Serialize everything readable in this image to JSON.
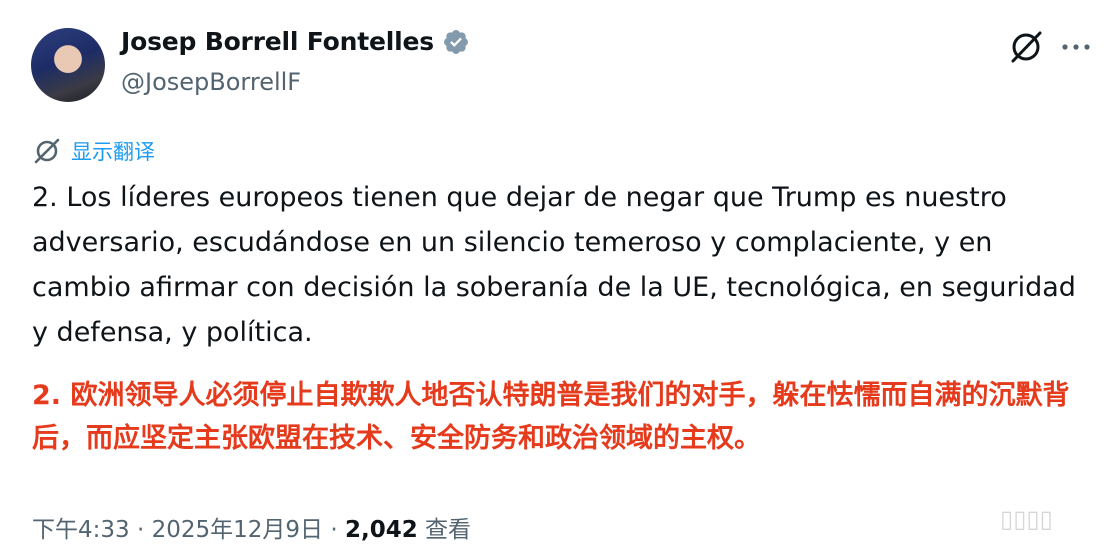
{
  "author": {
    "display_name": "Josep Borrell Fontelles",
    "handle": "@JosepBorrellF",
    "verified_icon": "verified-badge-icon"
  },
  "actions": {
    "grok_icon": "grok-icon",
    "more_icon": "more-horizontal-icon"
  },
  "translate": {
    "icon": "translate-icon",
    "label": "显示翻译"
  },
  "post": {
    "text": "2. Los líderes europeos tienen que dejar de negar que Trump es nuestro adversario, escudándose en un silencio temeroso y complaciente, y en cambio afirmar con decisión la soberanía de la UE, tecnológica,  en seguridad y defensa, y política.",
    "translation_overlay": "2. 欧洲领导人必须停止自欺欺人地否认特朗普是我们的对手，躲在怯懦而自满的沉默背后，而应坚定主张欧盟在技术、安全防务和政治领域的主权。"
  },
  "meta": {
    "time": "下午4:33",
    "sep1": " · ",
    "date": "2025年12月9日",
    "sep2": " · ",
    "views_count": "2,042",
    "views_label": " 查看"
  },
  "colors": {
    "accent": "#1d9bf0",
    "overlay_text": "#e63a1c",
    "secondary_text": "#536471"
  }
}
